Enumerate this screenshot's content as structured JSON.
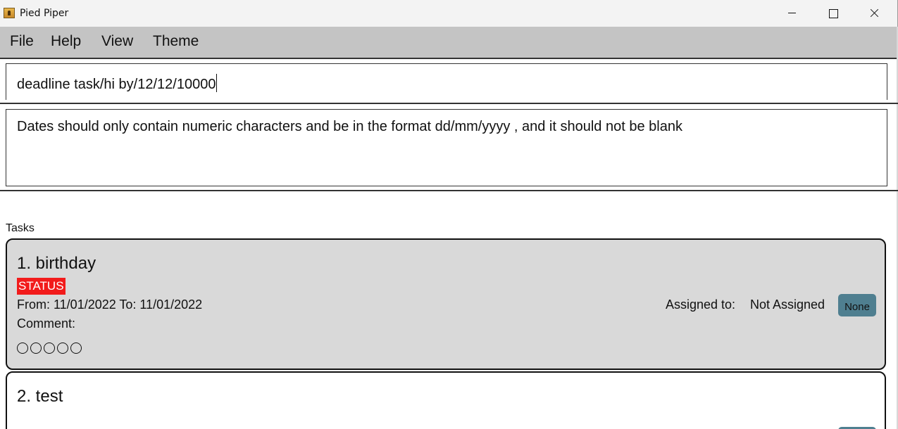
{
  "window": {
    "title": "Pied Piper",
    "app_icon": "pied-piper-app-icon",
    "controls": [
      "minimize-icon",
      "maximize-icon",
      "close-icon"
    ]
  },
  "menu": {
    "items": [
      {
        "label": "File"
      },
      {
        "label": "Help"
      },
      {
        "label": "View"
      },
      {
        "label": "Theme"
      }
    ]
  },
  "command_box": {
    "value": "deadline task/hi by/12/12/10000"
  },
  "result_display": {
    "text": "Dates should only contain numeric characters and be in the format dd/mm/yyyy , and it should not be blank"
  },
  "task_list": {
    "label": "Tasks",
    "tasks": [
      {
        "title": "1. birthday",
        "status": "STATUS",
        "dates": "From: 11/01/2022 To: 11/01/2022",
        "comment": "Comment:",
        "assigned_label": "Assigned to:",
        "assigned_value": "Not Assigned",
        "priority": "None",
        "rating": 0,
        "rating_max": 5
      },
      {
        "title": "2. test"
      }
    ]
  },
  "colors": {
    "menubar_bg": "#c4c4c4",
    "card_selected_bg": "#d9d9d9",
    "status_badge_bg": "#f21b1b",
    "priority_tag_bg": "#4f7f90"
  }
}
